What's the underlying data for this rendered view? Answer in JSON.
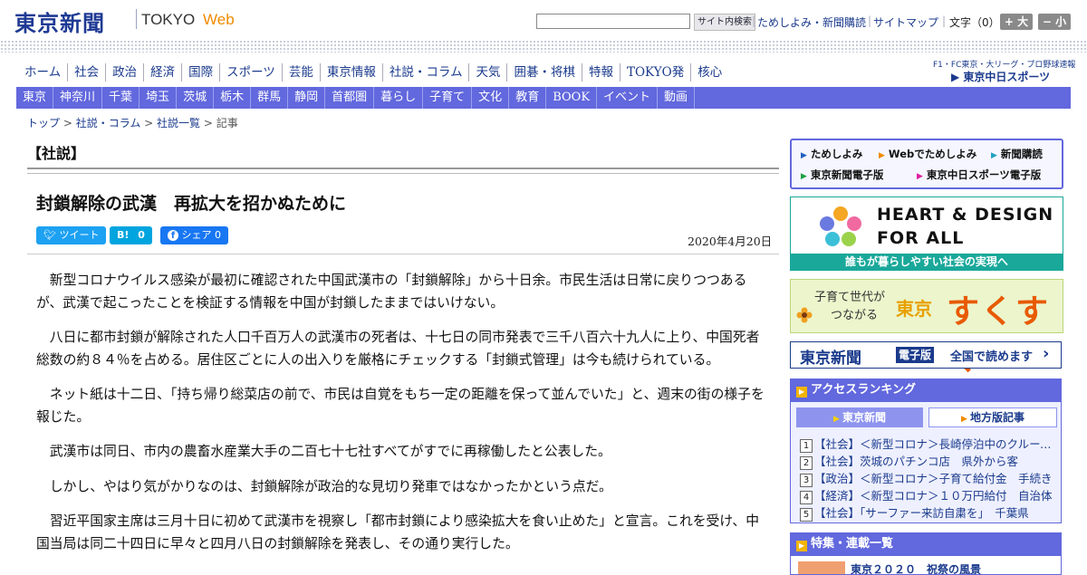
{
  "header": {
    "logo_jp": "東京新聞",
    "logo_tokyo": "TOKYO",
    "logo_web": "Web",
    "search_button": "サイト内検索",
    "links": [
      "ためしよみ・新聞購読",
      "サイトマップ"
    ],
    "font_label": "文字（0）",
    "font_larger": "+ 大",
    "font_smaller": "− 小"
  },
  "nav_main": [
    "ホーム",
    "社会",
    "政治",
    "経済",
    "国際",
    "スポーツ",
    "芸能",
    "東京情報",
    "社説・コラム",
    "天気",
    "囲碁・将棋",
    "特報",
    "TOKYO発",
    "核心"
  ],
  "chunichi": {
    "small": "F1・FC東京・大リーグ・プロ野球速報",
    "logo": "東京中日スポーツ"
  },
  "nav_region": [
    "東京",
    "神奈川",
    "千葉",
    "埼玉",
    "茨城",
    "栃木",
    "群馬",
    "静岡",
    "首都圏",
    "暮らし",
    "子育て",
    "文化",
    "教育",
    "BOOK",
    "イベント",
    "動画"
  ],
  "breadcrumb": {
    "items": [
      "トップ",
      "社説・コラム",
      "社説一覧"
    ],
    "current": "記事",
    "sep": " > "
  },
  "article": {
    "section": "【社説】",
    "headline": "封鎖解除の武漢　再拡大を招かぬために",
    "date": "2020年4月20日",
    "share": {
      "tweet": "ツイート",
      "hatena": "B!",
      "hatena_count": "0",
      "facebook": "シェア",
      "facebook_count": "0"
    },
    "paragraphs": [
      "新型コロナウイルス感染が最初に確認された中国武漢市の「封鎖解除」から十日余。市民生活は日常に戻りつつあるが、武漢で起こったことを検証する情報を中国が封鎖したままではいけない。",
      "八日に都市封鎖が解除された人口千百万人の武漢市の死者は、十七日の同市発表で三千八百六十九人に上り、中国死者総数の約８４％を占める。居住区ごとに人の出入りを厳格にチェックする「封鎖式管理」は今も続けられている。",
      "ネット紙は十二日、「持ち帰り総菜店の前で、市民は自覚をもち一定の距離を保って並んでいた」と、週末の街の様子を報じた。",
      "武漢市は同日、市内の農畜水産業大手の二百七十七社すべてがすでに再稼働したと公表した。",
      "しかし、やはり気がかりなのは、封鎖解除が政治的な見切り発車ではなかったかという点だ。",
      "習近平国家主席は三月十日に初めて武漢市を視察し「都市封鎖により感染拡大を食い止めた」と宣言。これを受け、中国当局は同二十四日に早々と四月八日の封鎖解除を発表し、その通り実行した。"
    ]
  },
  "sidebar": {
    "subscribe": [
      "ためしよみ",
      "Webでためしよみ",
      "新聞購読",
      "東京新聞電子版",
      "東京中日スポーツ電子版"
    ],
    "heart_design": {
      "line1": "HEART & DESIGN",
      "line2": "FOR ALL",
      "footer": "誰もが暮らしやすい社会の実現へ"
    },
    "sukusuku": {
      "line1": "子育て世代が",
      "line2": "つながる",
      "tokyo": "東京",
      "name": "すくすく"
    },
    "edition": {
      "logo": "東京新聞",
      "badge": "電子版",
      "text": "全国で読めます",
      "arrow": "›"
    },
    "ranking": {
      "title": "アクセスランキング",
      "tab_active": "東京新聞",
      "tab_inactive": "地方版記事",
      "items": [
        "【社会】＜新型コロナ＞長崎停泊中のクルーズ船",
        "【社会】茨城のパチンコ店　県外から客",
        "【政治】＜新型コロナ＞子育て給付金　手続き",
        "【経済】＜新型コロナ＞１０万円給付　自治体",
        "【社会】「サーファー来訪自粛を」　千葉県"
      ]
    },
    "features": {
      "title": "特集・連載一覧",
      "item": "東京２０２０　祝祭の風景"
    }
  },
  "colors": {
    "nav_bar": "#6268dd",
    "brand_blue": "#1a3a8c",
    "accent_orange": "#f08a00",
    "twitter": "#1da1f2",
    "hatena": "#00a4de",
    "facebook": "#1877f2"
  }
}
